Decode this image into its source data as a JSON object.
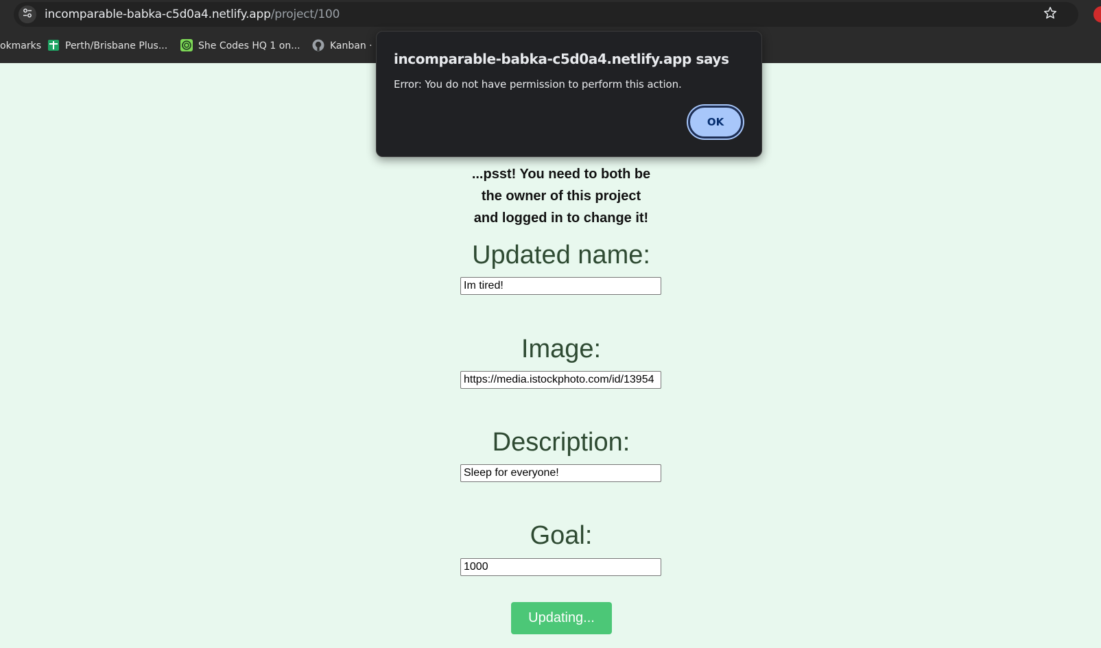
{
  "browser": {
    "url_host": "incomparable-babka-c5d0a4.netlify.app",
    "url_path": "/project/100",
    "bookmarks": [
      {
        "label": "okmarks",
        "icon": "bookmarks-truncated"
      },
      {
        "label": "Perth/Brisbane Plus...",
        "icon": "green-plus-sheet-icon"
      },
      {
        "label": "She Codes HQ 1 on...",
        "icon": "green-swirl-icon"
      },
      {
        "label": "Kanban · F",
        "icon": "github-icon"
      }
    ]
  },
  "alert": {
    "title": "incomparable-babka-c5d0a4.netlify.app says",
    "message": "Error: You do not have permission to perform this action.",
    "ok_label": "OK"
  },
  "page": {
    "notice_lines": [
      "...psst! You need to both be",
      "the owner of this project",
      "and logged in to change it!"
    ],
    "fields": {
      "name": {
        "label": "Updated name:",
        "value": "Im tired!"
      },
      "image": {
        "label": "Image:",
        "value": "https://media.istockphoto.com/id/13954"
      },
      "description": {
        "label": "Description:",
        "value": "Sleep for everyone!"
      },
      "goal": {
        "label": "Goal:",
        "value": "1000"
      }
    },
    "submit_label": "Updating..."
  },
  "colors": {
    "page_bg": "#e8f8ee",
    "label_text": "#2e4a32",
    "button_bg": "#4cc777",
    "dialog_bg": "#202124",
    "ok_button": "#a8c7fa"
  }
}
